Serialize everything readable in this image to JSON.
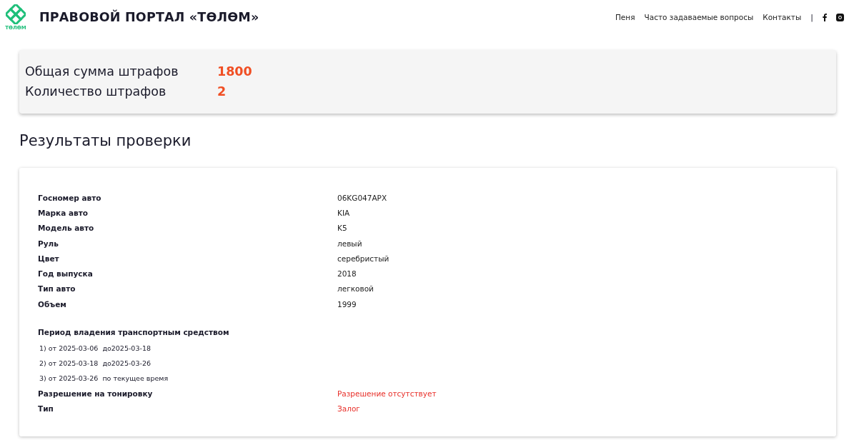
{
  "header": {
    "logo_text": "ТӨЛӨМ",
    "title": "ПРАВОВОЙ ПОРТАЛ «ТӨЛӨМ»",
    "nav": [
      "Пеня",
      "Часто задаваемые вопросы",
      "Контакты"
    ],
    "separator": "|"
  },
  "summary": [
    {
      "label": "Общая сумма штрафов",
      "value": "1800"
    },
    {
      "label": "Количество штрафов",
      "value": "2"
    }
  ],
  "results_title": "Результаты проверки",
  "details": [
    {
      "label": "Госномер авто",
      "value": "06KG047APX",
      "alert": false
    },
    {
      "label": "Марка авто",
      "value": "KIA",
      "alert": false
    },
    {
      "label": "Модель авто",
      "value": "K5",
      "alert": false
    },
    {
      "label": "Руль",
      "value": "левый",
      "alert": false
    },
    {
      "label": "Цвет",
      "value": "серебристый",
      "alert": false
    },
    {
      "label": "Год выпуска",
      "value": "2018",
      "alert": false
    },
    {
      "label": "Тип авто",
      "value": "легковой",
      "alert": false
    },
    {
      "label": "Объем",
      "value": "1999",
      "alert": false
    }
  ],
  "ownership": {
    "title": "Период владения транспортным средством",
    "periods": [
      "1) от 2025-03-06  до2025-03-18",
      "2) от 2025-03-18  до2025-03-26",
      "3) от 2025-03-26  по текущее время"
    ]
  },
  "extra": [
    {
      "label": "Разрешение на тонировку",
      "value": "Разрешение отсутствует",
      "alert": true
    },
    {
      "label": "Тип",
      "value": "Залог",
      "alert": true
    }
  ]
}
